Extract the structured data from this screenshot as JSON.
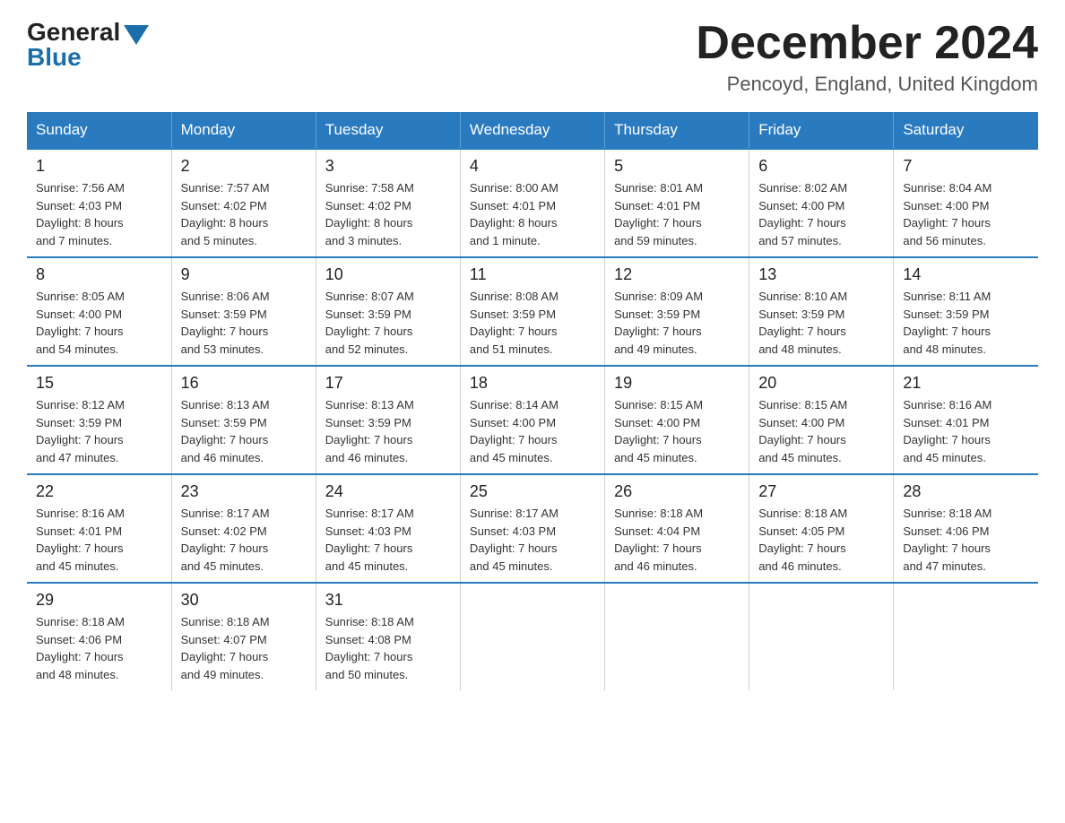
{
  "header": {
    "logo_general": "General",
    "logo_blue": "Blue",
    "month_title": "December 2024",
    "location": "Pencoyd, England, United Kingdom"
  },
  "days_of_week": [
    "Sunday",
    "Monday",
    "Tuesday",
    "Wednesday",
    "Thursday",
    "Friday",
    "Saturday"
  ],
  "weeks": [
    [
      {
        "day": "1",
        "sunrise": "7:56 AM",
        "sunset": "4:03 PM",
        "daylight": "8 hours and 7 minutes."
      },
      {
        "day": "2",
        "sunrise": "7:57 AM",
        "sunset": "4:02 PM",
        "daylight": "8 hours and 5 minutes."
      },
      {
        "day": "3",
        "sunrise": "7:58 AM",
        "sunset": "4:02 PM",
        "daylight": "8 hours and 3 minutes."
      },
      {
        "day": "4",
        "sunrise": "8:00 AM",
        "sunset": "4:01 PM",
        "daylight": "8 hours and 1 minute."
      },
      {
        "day": "5",
        "sunrise": "8:01 AM",
        "sunset": "4:01 PM",
        "daylight": "7 hours and 59 minutes."
      },
      {
        "day": "6",
        "sunrise": "8:02 AM",
        "sunset": "4:00 PM",
        "daylight": "7 hours and 57 minutes."
      },
      {
        "day": "7",
        "sunrise": "8:04 AM",
        "sunset": "4:00 PM",
        "daylight": "7 hours and 56 minutes."
      }
    ],
    [
      {
        "day": "8",
        "sunrise": "8:05 AM",
        "sunset": "4:00 PM",
        "daylight": "7 hours and 54 minutes."
      },
      {
        "day": "9",
        "sunrise": "8:06 AM",
        "sunset": "3:59 PM",
        "daylight": "7 hours and 53 minutes."
      },
      {
        "day": "10",
        "sunrise": "8:07 AM",
        "sunset": "3:59 PM",
        "daylight": "7 hours and 52 minutes."
      },
      {
        "day": "11",
        "sunrise": "8:08 AM",
        "sunset": "3:59 PM",
        "daylight": "7 hours and 51 minutes."
      },
      {
        "day": "12",
        "sunrise": "8:09 AM",
        "sunset": "3:59 PM",
        "daylight": "7 hours and 49 minutes."
      },
      {
        "day": "13",
        "sunrise": "8:10 AM",
        "sunset": "3:59 PM",
        "daylight": "7 hours and 48 minutes."
      },
      {
        "day": "14",
        "sunrise": "8:11 AM",
        "sunset": "3:59 PM",
        "daylight": "7 hours and 48 minutes."
      }
    ],
    [
      {
        "day": "15",
        "sunrise": "8:12 AM",
        "sunset": "3:59 PM",
        "daylight": "7 hours and 47 minutes."
      },
      {
        "day": "16",
        "sunrise": "8:13 AM",
        "sunset": "3:59 PM",
        "daylight": "7 hours and 46 minutes."
      },
      {
        "day": "17",
        "sunrise": "8:13 AM",
        "sunset": "3:59 PM",
        "daylight": "7 hours and 46 minutes."
      },
      {
        "day": "18",
        "sunrise": "8:14 AM",
        "sunset": "4:00 PM",
        "daylight": "7 hours and 45 minutes."
      },
      {
        "day": "19",
        "sunrise": "8:15 AM",
        "sunset": "4:00 PM",
        "daylight": "7 hours and 45 minutes."
      },
      {
        "day": "20",
        "sunrise": "8:15 AM",
        "sunset": "4:00 PM",
        "daylight": "7 hours and 45 minutes."
      },
      {
        "day": "21",
        "sunrise": "8:16 AM",
        "sunset": "4:01 PM",
        "daylight": "7 hours and 45 minutes."
      }
    ],
    [
      {
        "day": "22",
        "sunrise": "8:16 AM",
        "sunset": "4:01 PM",
        "daylight": "7 hours and 45 minutes."
      },
      {
        "day": "23",
        "sunrise": "8:17 AM",
        "sunset": "4:02 PM",
        "daylight": "7 hours and 45 minutes."
      },
      {
        "day": "24",
        "sunrise": "8:17 AM",
        "sunset": "4:03 PM",
        "daylight": "7 hours and 45 minutes."
      },
      {
        "day": "25",
        "sunrise": "8:17 AM",
        "sunset": "4:03 PM",
        "daylight": "7 hours and 45 minutes."
      },
      {
        "day": "26",
        "sunrise": "8:18 AM",
        "sunset": "4:04 PM",
        "daylight": "7 hours and 46 minutes."
      },
      {
        "day": "27",
        "sunrise": "8:18 AM",
        "sunset": "4:05 PM",
        "daylight": "7 hours and 46 minutes."
      },
      {
        "day": "28",
        "sunrise": "8:18 AM",
        "sunset": "4:06 PM",
        "daylight": "7 hours and 47 minutes."
      }
    ],
    [
      {
        "day": "29",
        "sunrise": "8:18 AM",
        "sunset": "4:06 PM",
        "daylight": "7 hours and 48 minutes."
      },
      {
        "day": "30",
        "sunrise": "8:18 AM",
        "sunset": "4:07 PM",
        "daylight": "7 hours and 49 minutes."
      },
      {
        "day": "31",
        "sunrise": "8:18 AM",
        "sunset": "4:08 PM",
        "daylight": "7 hours and 50 minutes."
      },
      null,
      null,
      null,
      null
    ]
  ],
  "labels": {
    "sunrise": "Sunrise:",
    "sunset": "Sunset:",
    "daylight": "Daylight:"
  }
}
